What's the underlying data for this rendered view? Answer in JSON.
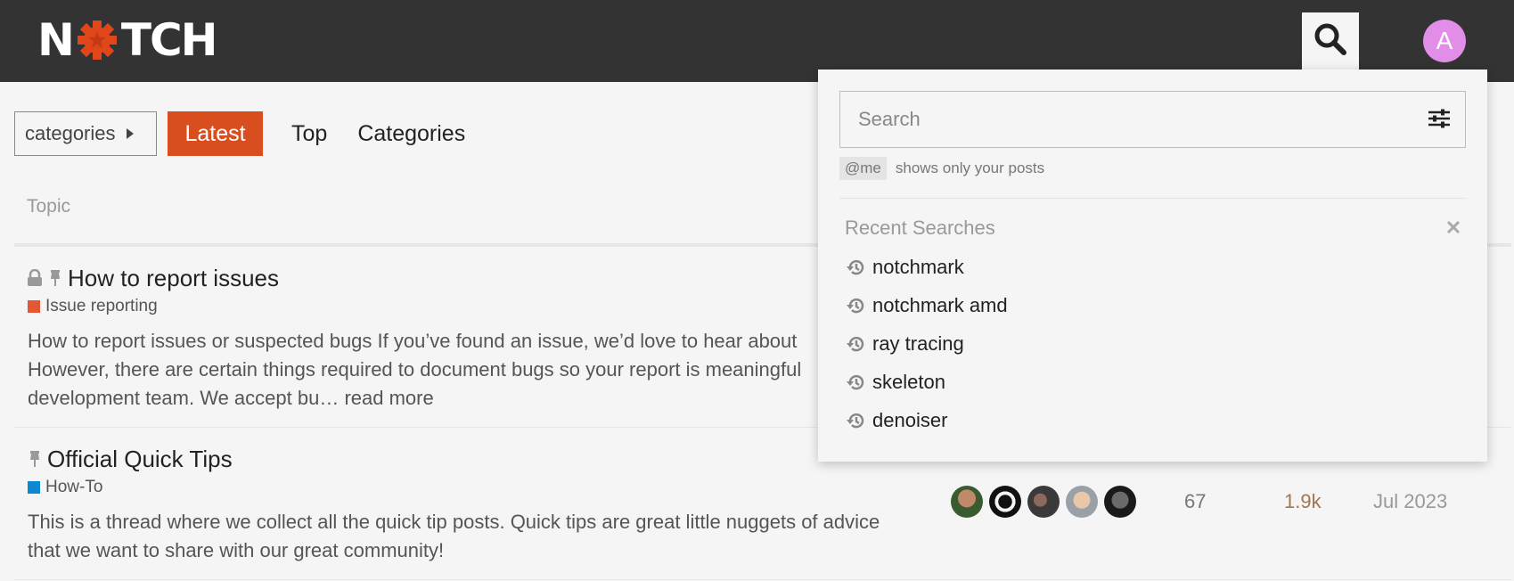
{
  "header": {
    "logo_text_left": "N",
    "logo_text_right": "TCH",
    "avatar_letter": "A",
    "brand_color": "#d94e1f"
  },
  "nav": {
    "categories_dropdown": "categories",
    "latest": "Latest",
    "top": "Top",
    "categories": "Categories"
  },
  "list": {
    "column_topic": "Topic",
    "topics": [
      {
        "title": "How to report issues",
        "category": "Issue reporting",
        "category_color": "#e45735",
        "icons": [
          "lock-icon",
          "pin-icon"
        ],
        "excerpt_1": "How to report issues or suspected bugs If you’ve found an issue, we’d love to hear about",
        "excerpt_2": "However, there are certain things required to document bugs so your report is meaningful",
        "excerpt_3": "development team. We accept bu… read more"
      },
      {
        "title": "Official Quick Tips",
        "category": "How-To",
        "category_color": "#0e88d1",
        "icons": [
          "pin-icon"
        ],
        "excerpt_1": "This is a thread where we collect all the quick tip posts. Quick tips are great little nuggets of advice",
        "excerpt_2": "that we want to share with our great community!",
        "replies": "67",
        "views": "1.9k",
        "activity": "Jul 2023"
      }
    ]
  },
  "search": {
    "placeholder": "Search",
    "tip_badge": "@me",
    "tip_text": "shows only your posts",
    "recent_title": "Recent Searches",
    "recent": [
      "notchmark",
      "notchmark amd",
      "ray tracing",
      "skeleton",
      "denoiser"
    ]
  }
}
